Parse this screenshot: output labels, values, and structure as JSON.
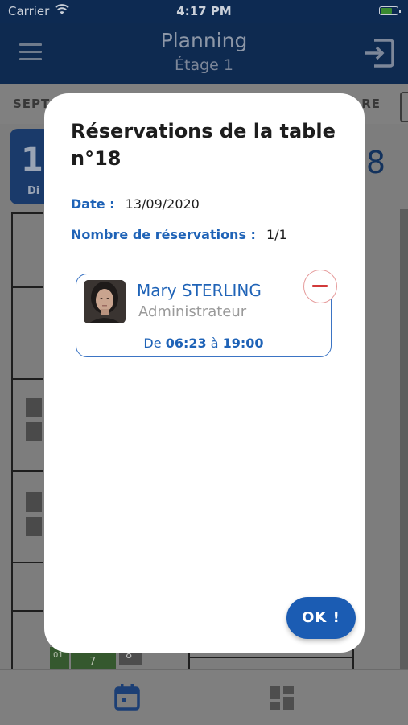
{
  "status_bar": {
    "carrier": "Carrier",
    "time": "4:17 PM"
  },
  "nav": {
    "title": "Planning",
    "subtitle": "Étage 1"
  },
  "background": {
    "month_left": "SEPT",
    "month_right": "RE",
    "day_number": "1",
    "day_label": "Di",
    "side_number": "8",
    "floor_numbers": [
      "01",
      "7",
      "8"
    ]
  },
  "modal": {
    "title": "Réservations de la table n°18",
    "date_label": "Date :",
    "date_value": "13/09/2020",
    "count_label": "Nombre de réservations :",
    "count_value": "1/1",
    "reservation": {
      "name": "Mary STERLING",
      "role": "Administrateur",
      "from_prefix": "De",
      "start": "06:23",
      "to_word": "à",
      "end": "19:00"
    },
    "ok_label": "OK !"
  },
  "colors": {
    "accent": "#1f63b7",
    "ok_button": "#1b5cb3",
    "remove": "#d23a3a"
  }
}
